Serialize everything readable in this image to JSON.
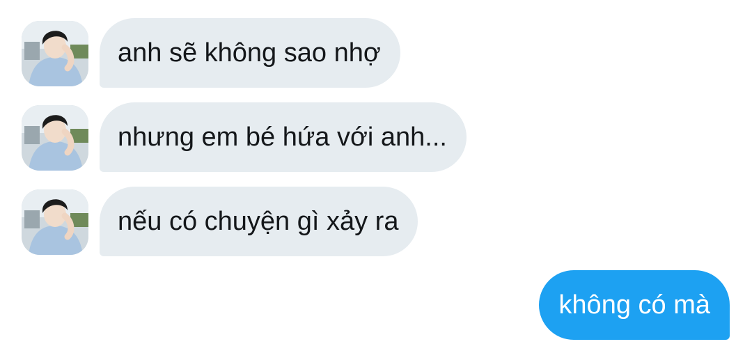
{
  "conversation": {
    "incoming": [
      {
        "text": "anh sẽ không sao nhợ"
      },
      {
        "text": "nhưng em bé hứa với anh..."
      },
      {
        "text": "nếu có chuyện gì xảy ra"
      }
    ],
    "outgoing": [
      {
        "text": "không có mà"
      }
    ]
  },
  "colors": {
    "incoming_bubble": "#e6ecf0",
    "outgoing_bubble": "#1da1f2",
    "incoming_text": "#14171a",
    "outgoing_text": "#ffffff"
  },
  "icons": {
    "sender_avatar": "avatar-photo"
  }
}
